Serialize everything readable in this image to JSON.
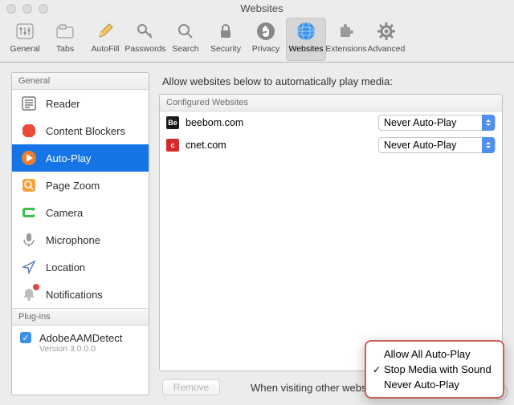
{
  "window": {
    "title": "Websites"
  },
  "toolbar": [
    {
      "id": "general",
      "label": "General"
    },
    {
      "id": "tabs",
      "label": "Tabs"
    },
    {
      "id": "autofill",
      "label": "AutoFill"
    },
    {
      "id": "passwords",
      "label": "Passwords"
    },
    {
      "id": "search",
      "label": "Search"
    },
    {
      "id": "security",
      "label": "Security"
    },
    {
      "id": "privacy",
      "label": "Privacy"
    },
    {
      "id": "websites",
      "label": "Websites",
      "selected": true
    },
    {
      "id": "extensions",
      "label": "Extensions"
    },
    {
      "id": "advanced",
      "label": "Advanced"
    }
  ],
  "sidebar": {
    "general_header": "General",
    "items": [
      {
        "id": "reader",
        "label": "Reader"
      },
      {
        "id": "content-blockers",
        "label": "Content Blockers"
      },
      {
        "id": "auto-play",
        "label": "Auto-Play",
        "selected": true
      },
      {
        "id": "page-zoom",
        "label": "Page Zoom"
      },
      {
        "id": "camera",
        "label": "Camera"
      },
      {
        "id": "microphone",
        "label": "Microphone"
      },
      {
        "id": "location",
        "label": "Location"
      },
      {
        "id": "notifications",
        "label": "Notifications"
      }
    ],
    "plugins_header": "Plug-ins",
    "plugins": [
      {
        "id": "adobeaam",
        "label": "AdobeAAMDetect",
        "version": "Version 3.0.0.0",
        "enabled": true
      }
    ]
  },
  "content": {
    "heading": "Allow websites below to automatically play media:",
    "table_header": "Configured Websites",
    "sites": [
      {
        "favcolor": "#1a1a1a",
        "favtext": "Be",
        "domain": "beebom.com",
        "policy": "Never Auto-Play"
      },
      {
        "favcolor": "#d82a2a",
        "favtext": "c",
        "domain": "cnet.com",
        "policy": "Never Auto-Play"
      }
    ],
    "remove_label": "Remove",
    "other_label": "When visiting other websites"
  },
  "popup": {
    "items": [
      {
        "label": "Allow All Auto-Play",
        "checked": false
      },
      {
        "label": "Stop Media with Sound",
        "checked": true
      },
      {
        "label": "Never Auto-Play",
        "checked": false
      }
    ]
  },
  "help_label": "?"
}
